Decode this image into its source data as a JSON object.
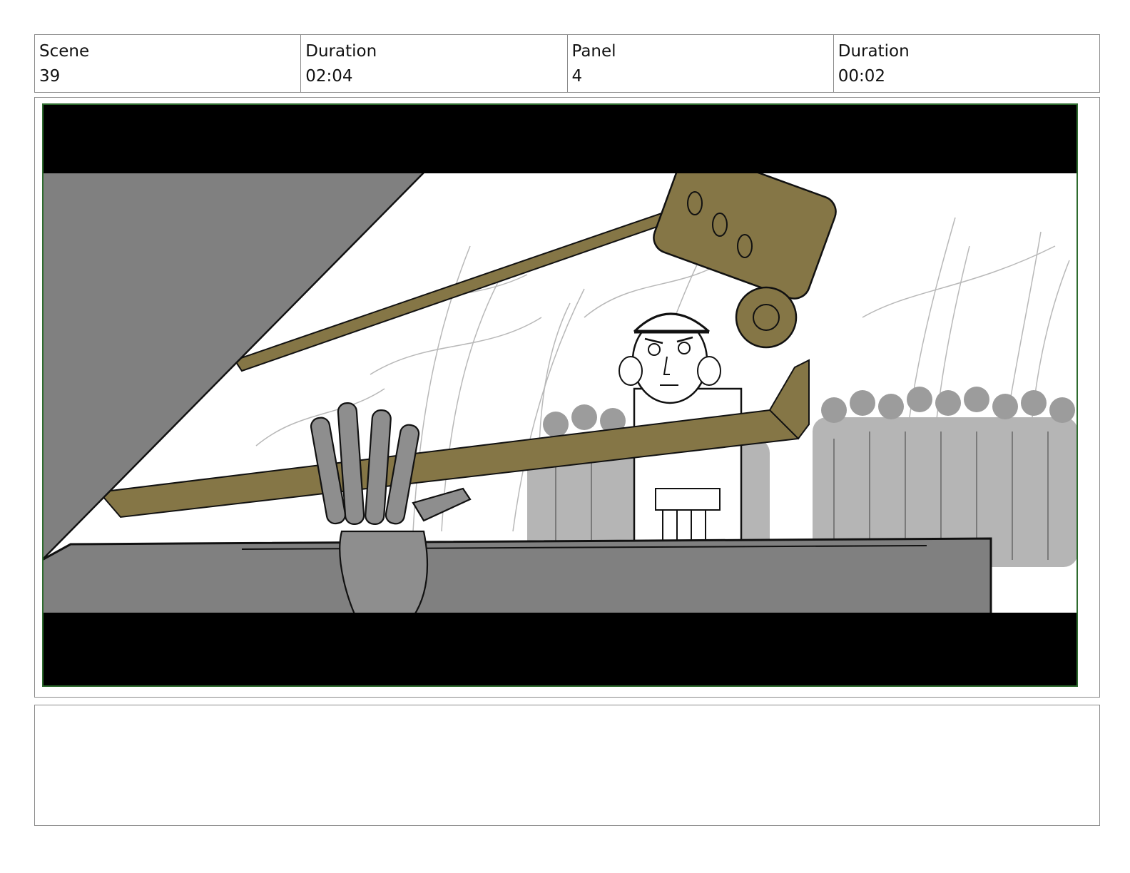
{
  "header": {
    "scene_label": "Scene",
    "scene_value": "39",
    "scene_duration_label": "Duration",
    "scene_duration_value": "02:04",
    "panel_label": "Panel",
    "panel_value": "4",
    "panel_duration_label": "Duration",
    "panel_duration_value": "00:02"
  },
  "panel_image": {
    "description_icon": "storyboard-sketch",
    "colors": {
      "frame_border": "#2e6b2e",
      "letterbox": "#000000",
      "olive_prop": "#857646",
      "shadow_gray": "#808080",
      "crowd_gray": "#b5b5b5"
    }
  },
  "notes": {
    "text": ""
  }
}
